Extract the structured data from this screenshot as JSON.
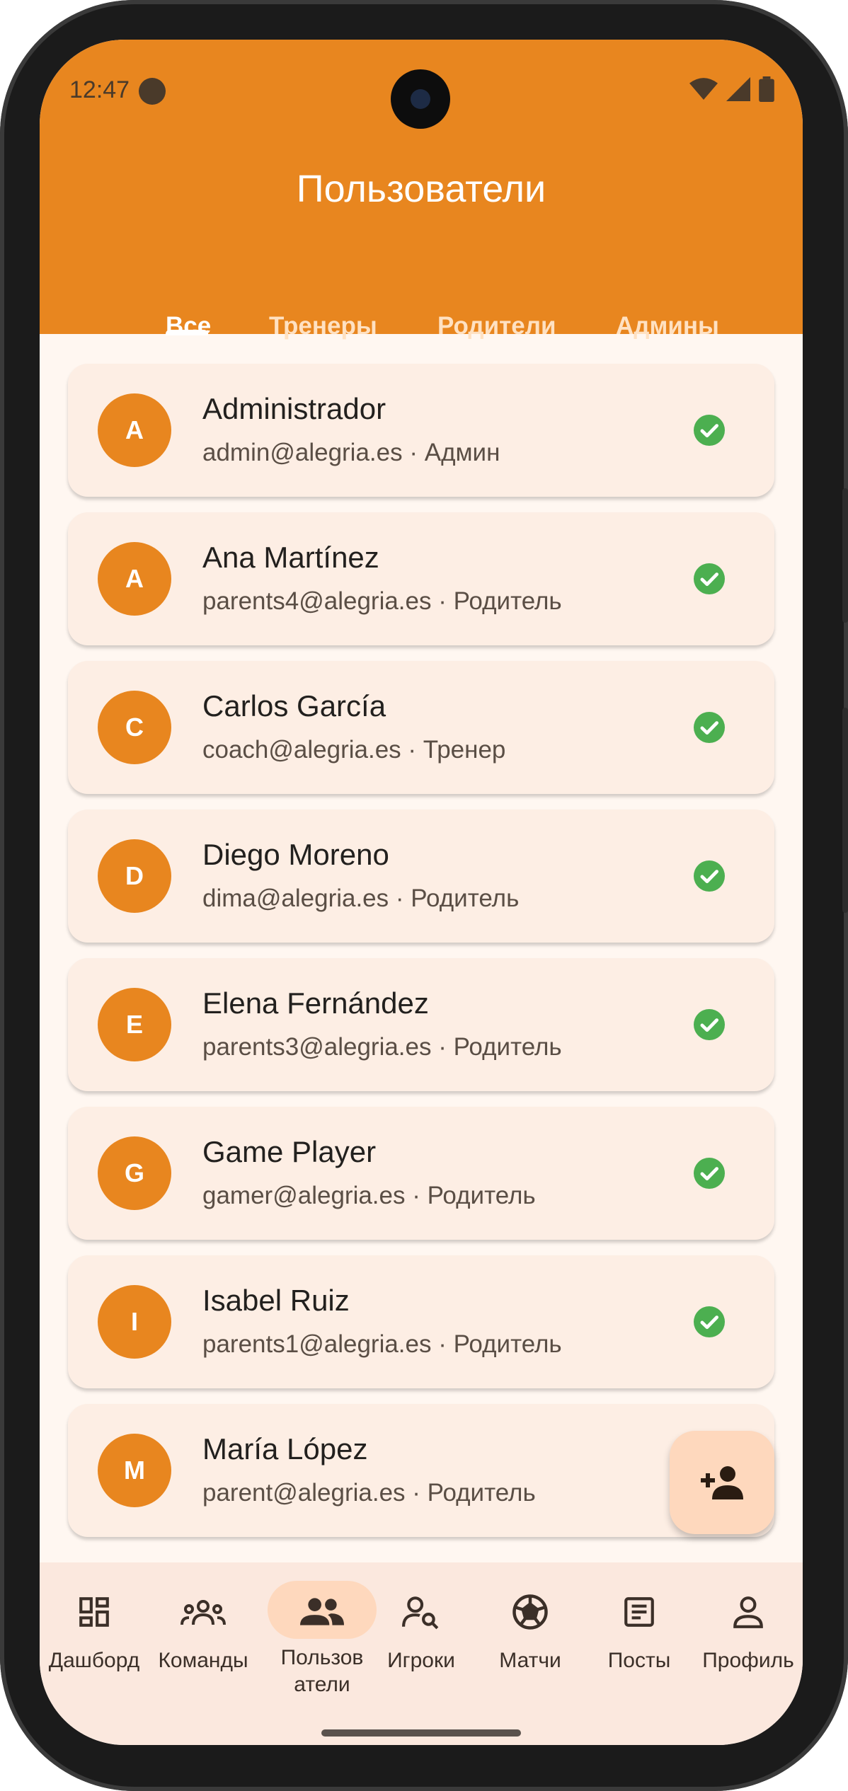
{
  "status": {
    "time": "12:47"
  },
  "header": {
    "title": "Пользователи"
  },
  "tabs": [
    {
      "label": "Все",
      "active": true
    },
    {
      "label": "Тренеры",
      "active": false
    },
    {
      "label": "Родители",
      "active": false
    },
    {
      "label": "Админы",
      "active": false
    }
  ],
  "users": [
    {
      "initial": "A",
      "name": "Administrador",
      "subtitle": "admin@alegria.es · Админ",
      "verified": true
    },
    {
      "initial": "A",
      "name": "Ana Martínez",
      "subtitle": "parents4@alegria.es · Родитель",
      "verified": true
    },
    {
      "initial": "C",
      "name": "Carlos García",
      "subtitle": "coach@alegria.es · Тренер",
      "verified": true
    },
    {
      "initial": "D",
      "name": "Diego Moreno",
      "subtitle": "dima@alegria.es · Родитель",
      "verified": true
    },
    {
      "initial": "E",
      "name": "Elena Fernández",
      "subtitle": "parents3@alegria.es · Родитель",
      "verified": true
    },
    {
      "initial": "G",
      "name": "Game Player",
      "subtitle": "gamer@alegria.es · Родитель",
      "verified": true
    },
    {
      "initial": "I",
      "name": "Isabel Ruiz",
      "subtitle": "parents1@alegria.es · Родитель",
      "verified": true
    },
    {
      "initial": "M",
      "name": "María López",
      "subtitle": "parent@alegria.es · Родитель",
      "verified": false
    }
  ],
  "fab": {
    "icon": "person-add-icon"
  },
  "nav": [
    {
      "label": "Дашборд",
      "icon": "dashboard-icon",
      "active": false
    },
    {
      "label": "Команды",
      "icon": "groups-icon",
      "active": false
    },
    {
      "label": "Пользов\nатели",
      "icon": "people-icon",
      "active": true
    },
    {
      "label": "Игроки",
      "icon": "person-search-icon",
      "active": false
    },
    {
      "label": "Матчи",
      "icon": "soccer-ball-icon",
      "active": false
    },
    {
      "label": "Посты",
      "icon": "article-icon",
      "active": false
    },
    {
      "label": "Профиль",
      "icon": "person-icon",
      "active": false
    }
  ],
  "colors": {
    "primary": "#e8861f",
    "background": "#fff7f1",
    "card": "#fdeee4",
    "verified": "#4caf50",
    "fab": "#fed8bd"
  }
}
